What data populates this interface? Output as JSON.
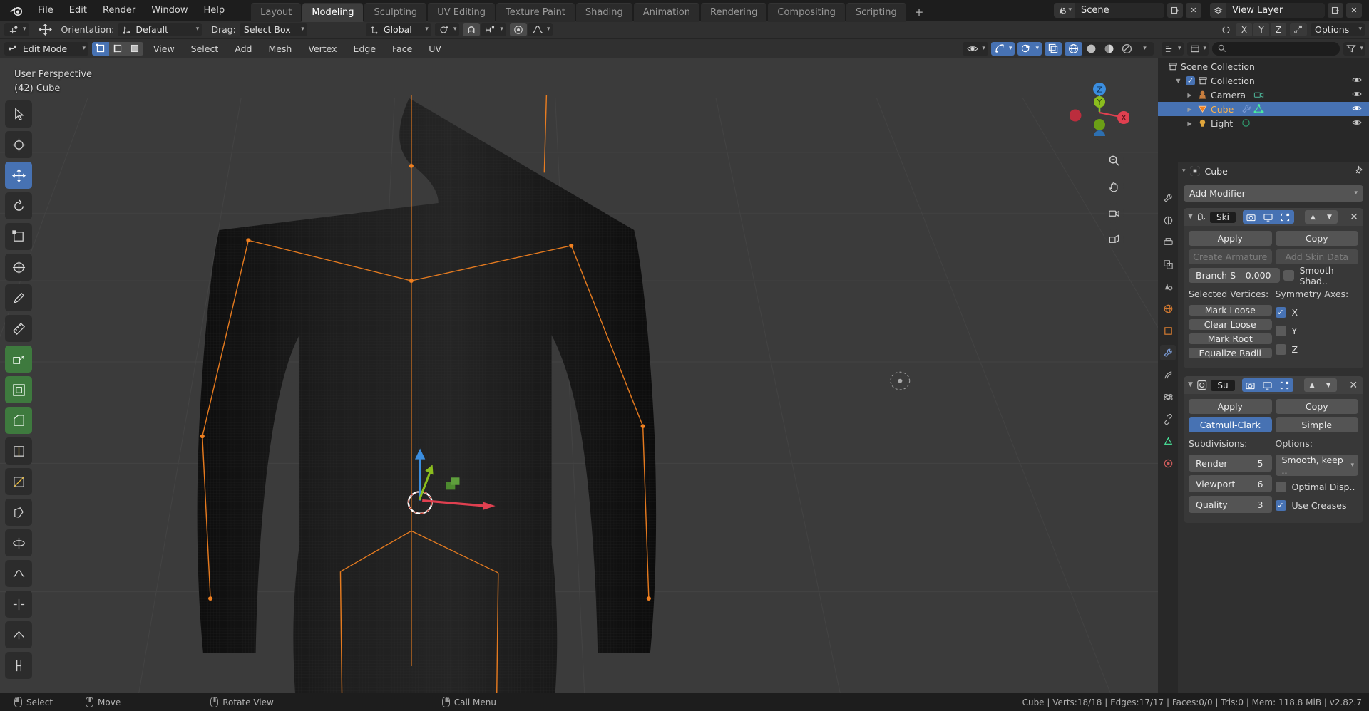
{
  "topbar": {
    "logo_icon": "blender-logo-icon",
    "menus": [
      "File",
      "Edit",
      "Render",
      "Window",
      "Help"
    ],
    "workspace_tabs": [
      "Layout",
      "Modeling",
      "Sculpting",
      "UV Editing",
      "Texture Paint",
      "Shading",
      "Animation",
      "Rendering",
      "Compositing",
      "Scripting"
    ],
    "active_workspace": "Modeling",
    "add_workspace_label": "+",
    "scene_icon": "scene-icon",
    "scene_name": "Scene",
    "new_scene_icon": "new-scene-icon",
    "remove_scene_icon": "remove-scene-icon",
    "viewlayer_icon": "viewlayer-icon",
    "viewlayer_name": "View Layer",
    "new_viewlayer_icon": "new-viewlayer-icon",
    "remove_viewlayer_icon": "remove-viewlayer-icon"
  },
  "toolrow": {
    "transform_pivot_icon": "transform-pivot-icon",
    "move_tool_icon": "move-tool-icon",
    "orientation_label": "Orientation:",
    "orientation_value": "Default",
    "drag_label": "Drag:",
    "drag_value": "Select Box",
    "transform_orientation_icon": "orientation-axis-icon",
    "global_value": "Global",
    "pivot_icon": "pivot-point-icon",
    "snap_magnet_icon": "snap-magnet-icon",
    "snap_increment_icon": "snap-increment-icon",
    "proportional_icon": "proportional-edit-icon",
    "falloff_icon": "falloff-curve-icon",
    "mirror_icon": "mirror-icon",
    "axes": [
      "X",
      "Y",
      "Z"
    ],
    "auto_merge_icon": "auto-merge-icon",
    "options_label": "Options"
  },
  "viewport_header": {
    "mode_icon": "edit-mode-icon",
    "mode_value": "Edit Mode",
    "select_modes": [
      "vertex-select-icon",
      "edge-select-icon",
      "face-select-icon"
    ],
    "active_select_mode": 0,
    "menus": [
      "View",
      "Select",
      "Add",
      "Mesh",
      "Vertex",
      "Edge",
      "Face",
      "UV"
    ],
    "visibility_icon": "visibility-eye-icon",
    "gizmo_icon": "gizmo-icon",
    "overlays_icon": "overlays-icon",
    "xray_icon": "toggle-xray-icon",
    "shading_modes": [
      "wireframe-shading-icon",
      "solid-shading-icon",
      "material-preview-icon",
      "rendered-shading-icon"
    ],
    "active_shading": 0
  },
  "viewport": {
    "perspective_label": "User Perspective",
    "object_label": "(42) Cube",
    "toolbar_icons": [
      "tweak-select-tool-icon",
      "cursor-tool-icon",
      "move-tool-icon",
      "rotate-tool-icon",
      "scale-tool-icon",
      "transform-tool-icon",
      "annotate-tool-icon",
      "measure-tool-icon",
      "extrude-region-tool-icon",
      "inset-faces-tool-icon",
      "bevel-tool-icon",
      "loop-cut-tool-icon",
      "knife-tool-icon",
      "poly-build-tool-icon",
      "spin-tool-icon",
      "smooth-tool-icon",
      "edge-slide-tool-icon",
      "shrink-fatten-tool-icon",
      "rip-region-tool-icon"
    ],
    "active_tool_index": 2,
    "gizmo_axes": [
      "Z",
      "Y",
      "X"
    ],
    "nav_icons": [
      "zoom-icon",
      "pan-hand-icon",
      "camera-view-icon",
      "ortho-persp-icon"
    ]
  },
  "outliner": {
    "editor_type_icon": "outliner-editor-icon",
    "display_mode_icon": "display-mode-icon",
    "search_icon": "search-icon",
    "search_placeholder": "",
    "filter_icon": "filter-icon",
    "rows": [
      {
        "name": "Scene Collection",
        "icon": "collection-icon",
        "indent": 0,
        "selected": false,
        "has_disclosure": false,
        "has_checkbox": false,
        "has_eye": false,
        "extra_icons": []
      },
      {
        "name": "Collection",
        "icon": "collection-icon",
        "indent": 1,
        "selected": false,
        "has_disclosure": true,
        "disclosure_open": true,
        "has_checkbox": true,
        "has_eye": true,
        "extra_icons": []
      },
      {
        "name": "Camera",
        "icon": "camera-object-icon",
        "indent": 2,
        "selected": false,
        "has_disclosure": true,
        "disclosure_open": false,
        "has_checkbox": false,
        "has_eye": true,
        "extra_icons": [
          "camera-data-icon"
        ]
      },
      {
        "name": "Cube",
        "icon": "mesh-object-icon",
        "indent": 2,
        "selected": true,
        "has_disclosure": true,
        "disclosure_open": false,
        "has_checkbox": false,
        "has_eye": true,
        "extra_icons": [
          "modifier-wrench-icon",
          "mesh-data-icon"
        ]
      },
      {
        "name": "Light",
        "icon": "light-object-icon",
        "indent": 2,
        "selected": false,
        "has_disclosure": true,
        "disclosure_open": false,
        "has_checkbox": false,
        "has_eye": true,
        "extra_icons": [
          "light-data-icon"
        ]
      }
    ]
  },
  "properties": {
    "editor_icon": "properties-editor-icon",
    "tabs": [
      "tool-tab-icon",
      "render-tab-icon",
      "output-tab-icon",
      "view-layer-tab-icon",
      "scene-tab-icon",
      "world-tab-icon",
      "object-tab-icon",
      "modifier-tab-icon",
      "particles-tab-icon",
      "physics-tab-icon",
      "constraints-tab-icon",
      "data-tab-icon",
      "material-tab-icon"
    ],
    "active_tab_index": 7,
    "breadcrumb_icon": "object-breadcrumb-icon",
    "breadcrumb_name": "Cube",
    "pin_icon": "pin-icon",
    "add_modifier_label": "Add Modifier",
    "modifiers": [
      {
        "type_icon": "skin-modifier-icon",
        "name": "Ski",
        "header_toggles": [
          "render-toggle-icon",
          "realtime-toggle-icon",
          "edit-mode-toggle-icon"
        ],
        "move_up_icon": "move-up-icon",
        "move_down_icon": "move-down-icon",
        "close_icon": "close-icon",
        "apply_label": "Apply",
        "copy_label": "Copy",
        "create_armature_label": "Create Armature",
        "add_skin_data_label": "Add Skin Data",
        "branch_label": "Branch S",
        "branch_value": "0.000",
        "smooth_shading_label": "Smooth Shad..",
        "smooth_shading_checked": false,
        "selected_vertices_label": "Selected Vertices:",
        "symmetry_axes_label": "Symmetry Axes:",
        "vertex_buttons": [
          "Mark Loose",
          "Clear Loose",
          "Mark Root",
          "Equalize Radii"
        ],
        "symmetry": [
          {
            "label": "X",
            "checked": true
          },
          {
            "label": "Y",
            "checked": false
          },
          {
            "label": "Z",
            "checked": false
          }
        ]
      },
      {
        "type_icon": "subsurf-modifier-icon",
        "name": "Su",
        "header_toggles": [
          "render-toggle-icon",
          "realtime-toggle-icon",
          "edit-mode-toggle-icon"
        ],
        "move_up_icon": "move-up-icon",
        "move_down_icon": "move-down-icon",
        "close_icon": "close-icon",
        "apply_label": "Apply",
        "copy_label": "Copy",
        "catmull_label": "Catmull-Clark",
        "simple_label": "Simple",
        "active_algorithm": "Catmull-Clark",
        "subdivisions_label": "Subdivisions:",
        "options_label": "Options:",
        "render_label": "Render",
        "render_value": "5",
        "viewport_label": "Viewport",
        "viewport_value": "6",
        "quality_label": "Quality",
        "quality_value": "3",
        "uv_smooth_value": "Smooth, keep ..",
        "optimal_display_label": "Optimal Disp..",
        "optimal_display_checked": false,
        "use_creases_label": "Use Creases",
        "use_creases_checked": true
      }
    ]
  },
  "statusbar": {
    "hints": [
      {
        "mouse": "left",
        "label": "Select"
      },
      {
        "mouse": "mid",
        "label": "Move"
      },
      {
        "mouse": "mid2",
        "label": "Rotate View"
      },
      {
        "mouse": "right",
        "label": "Call Menu"
      }
    ],
    "stats": "Cube | Verts:18/18 | Edges:17/17 | Faces:0/0 | Tris:0 | Mem: 118.8 MiB | v2.82.7"
  },
  "colors": {
    "accent_blue": "#4772b3",
    "selected_orange": "#ffb347",
    "panel_bg": "#303030",
    "viewport_bg": "#3b3b3b",
    "axis_x": "#e04050",
    "axis_y": "#8bbd1e",
    "axis_z": "#3b8ee0"
  }
}
